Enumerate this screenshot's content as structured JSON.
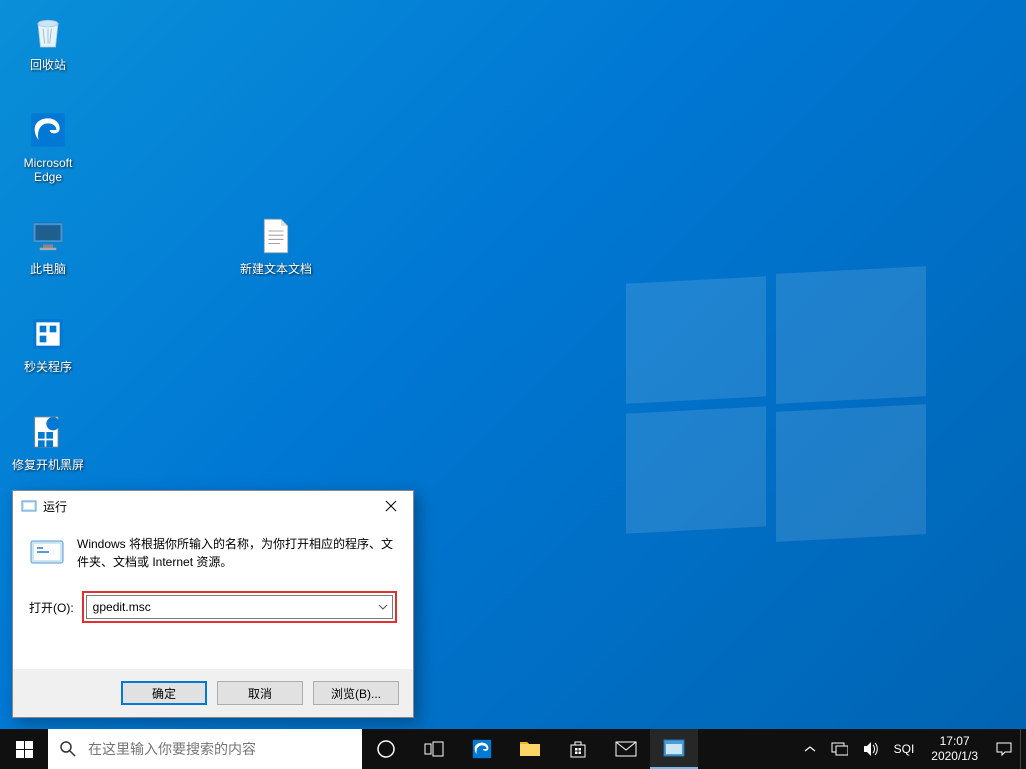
{
  "desktop_icons": {
    "recycle_bin": "回收站",
    "edge": "Microsoft Edge",
    "this_pc": "此电脑",
    "text_doc": "新建文本文档",
    "shutdown_app": "秒关程序",
    "repair_app": "修复开机黑屏"
  },
  "run": {
    "title": "运行",
    "description": "Windows 将根据你所输入的名称，为你打开相应的程序、文件夹、文档或 Internet 资源。",
    "open_label": "打开(O):",
    "input_value": "gpedit.msc",
    "ok": "确定",
    "cancel": "取消",
    "browse": "浏览(B)..."
  },
  "taskbar": {
    "search_placeholder": "在这里输入你要搜索的内容",
    "ime": "SQI",
    "time": "17:07",
    "date": "2020/1/3"
  }
}
